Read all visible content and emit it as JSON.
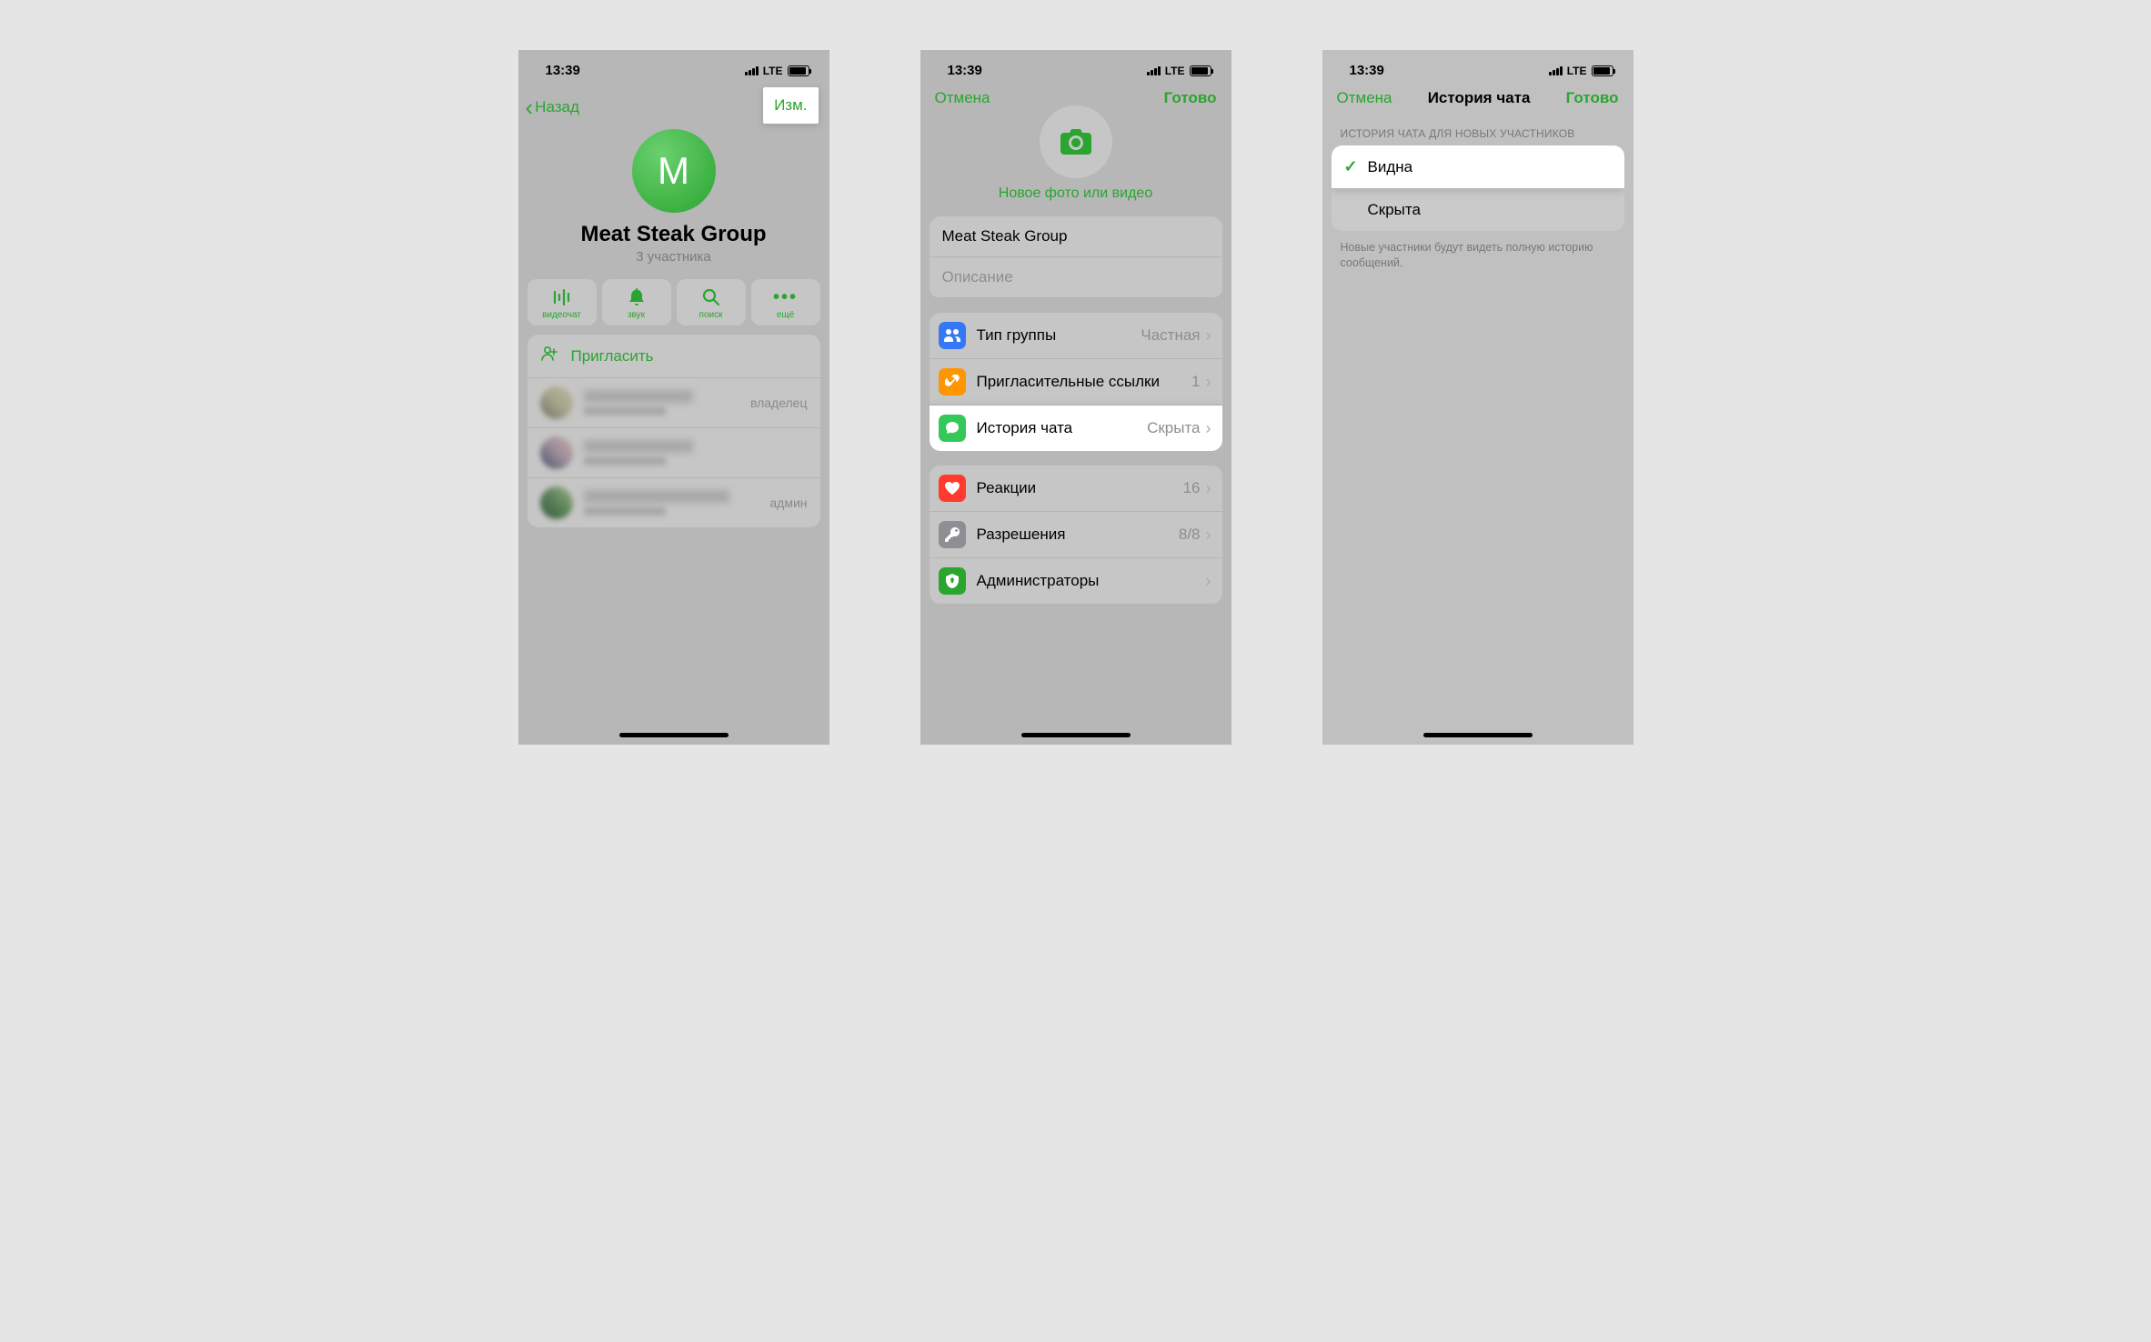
{
  "status": {
    "time": "13:39",
    "network": "LTE"
  },
  "screen1": {
    "back": "Назад",
    "edit": "Изм.",
    "avatar_letter": "M",
    "title": "Meat Steak Group",
    "subtitle": "3 участника",
    "actions": {
      "video": "видеочат",
      "sound": "звук",
      "search": "поиск",
      "more": "ещё"
    },
    "invite": "Пригласить",
    "roles": {
      "owner": "владелец",
      "admin": "админ"
    }
  },
  "screen2": {
    "cancel": "Отмена",
    "done": "Готово",
    "photo_link": "Новое фото или видео",
    "group_name": "Meat Steak Group",
    "desc_placeholder": "Описание",
    "rows": {
      "type": {
        "label": "Тип группы",
        "value": "Частная"
      },
      "links": {
        "label": "Пригласительные ссылки",
        "value": "1"
      },
      "history": {
        "label": "История чата",
        "value": "Скрыта"
      },
      "reactions": {
        "label": "Реакции",
        "value": "16"
      },
      "permissions": {
        "label": "Разрешения",
        "value": "8/8"
      },
      "admins": {
        "label": "Администраторы",
        "value": ""
      }
    }
  },
  "screen3": {
    "cancel": "Отмена",
    "title": "История чата",
    "done": "Готово",
    "section_header": "ИСТОРИЯ ЧАТА ДЛЯ НОВЫХ УЧАСТНИКОВ",
    "visible": "Видна",
    "hidden": "Скрыта",
    "footer": "Новые участники будут видеть полную историю сообщений."
  }
}
